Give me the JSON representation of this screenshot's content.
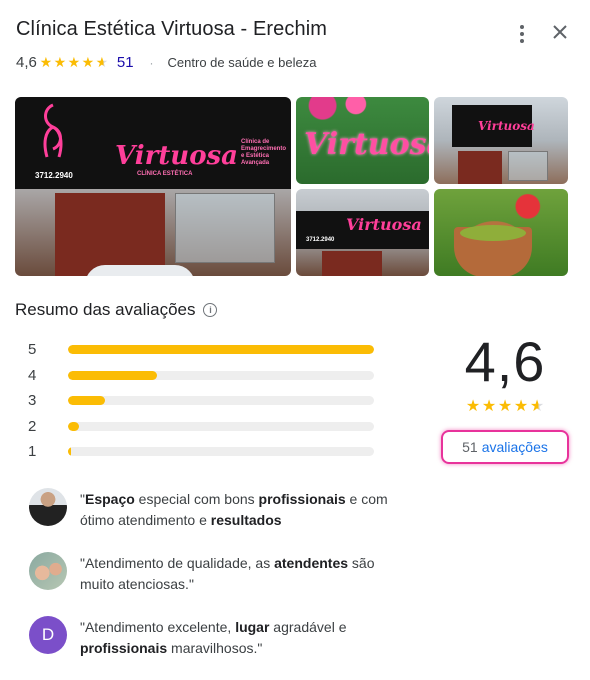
{
  "header": {
    "title": "Clínica Estética Virtuosa - Erechim",
    "rating": "4,6",
    "reviews_count": "51",
    "category": "Centro de saúde e beleza"
  },
  "photos": {
    "sign_brand": "Virtuosa",
    "sign_subtitle": "CLÍNICA ESTÉTICA",
    "sign_services": "Clínica de Emagrecimento e Estética Avançada",
    "sign_phone": "3712.2940"
  },
  "summary": {
    "title": "Resumo das avaliações",
    "rating": "4,6",
    "stars_value": 4.6,
    "reviews_count": "51",
    "reviews_label": "avaliações",
    "distribution": [
      {
        "label": "5",
        "fraction": 1.0
      },
      {
        "label": "4",
        "fraction": 0.29
      },
      {
        "label": "3",
        "fraction": 0.12
      },
      {
        "label": "2",
        "fraction": 0.035
      },
      {
        "label": "1",
        "fraction": 0.01
      }
    ]
  },
  "snippets": [
    {
      "avatar_letter": "",
      "parts": [
        [
          "\"",
          false
        ],
        [
          "Espaço",
          true
        ],
        [
          " especial com bons ",
          false
        ],
        [
          "profissionais",
          true
        ],
        [
          " e com ótimo atendimento e ",
          false
        ],
        [
          "resultados",
          true
        ]
      ]
    },
    {
      "avatar_letter": "",
      "parts": [
        [
          "\"Atendimento de qualidade, as ",
          false
        ],
        [
          "atendentes",
          true
        ],
        [
          " são muito atenciosas.\"",
          false
        ]
      ]
    },
    {
      "avatar_letter": "D",
      "parts": [
        [
          "\"Atendimento excelente, ",
          false
        ],
        [
          "lugar",
          true
        ],
        [
          " agradável e ",
          false
        ],
        [
          "profissionais",
          true
        ],
        [
          " maravilhosos.\"",
          false
        ]
      ]
    }
  ],
  "colors": {
    "star": "#fbbc04",
    "highlight": "#e8339b",
    "link": "#1a0dab",
    "avatar_d": "#7b4fc9"
  }
}
